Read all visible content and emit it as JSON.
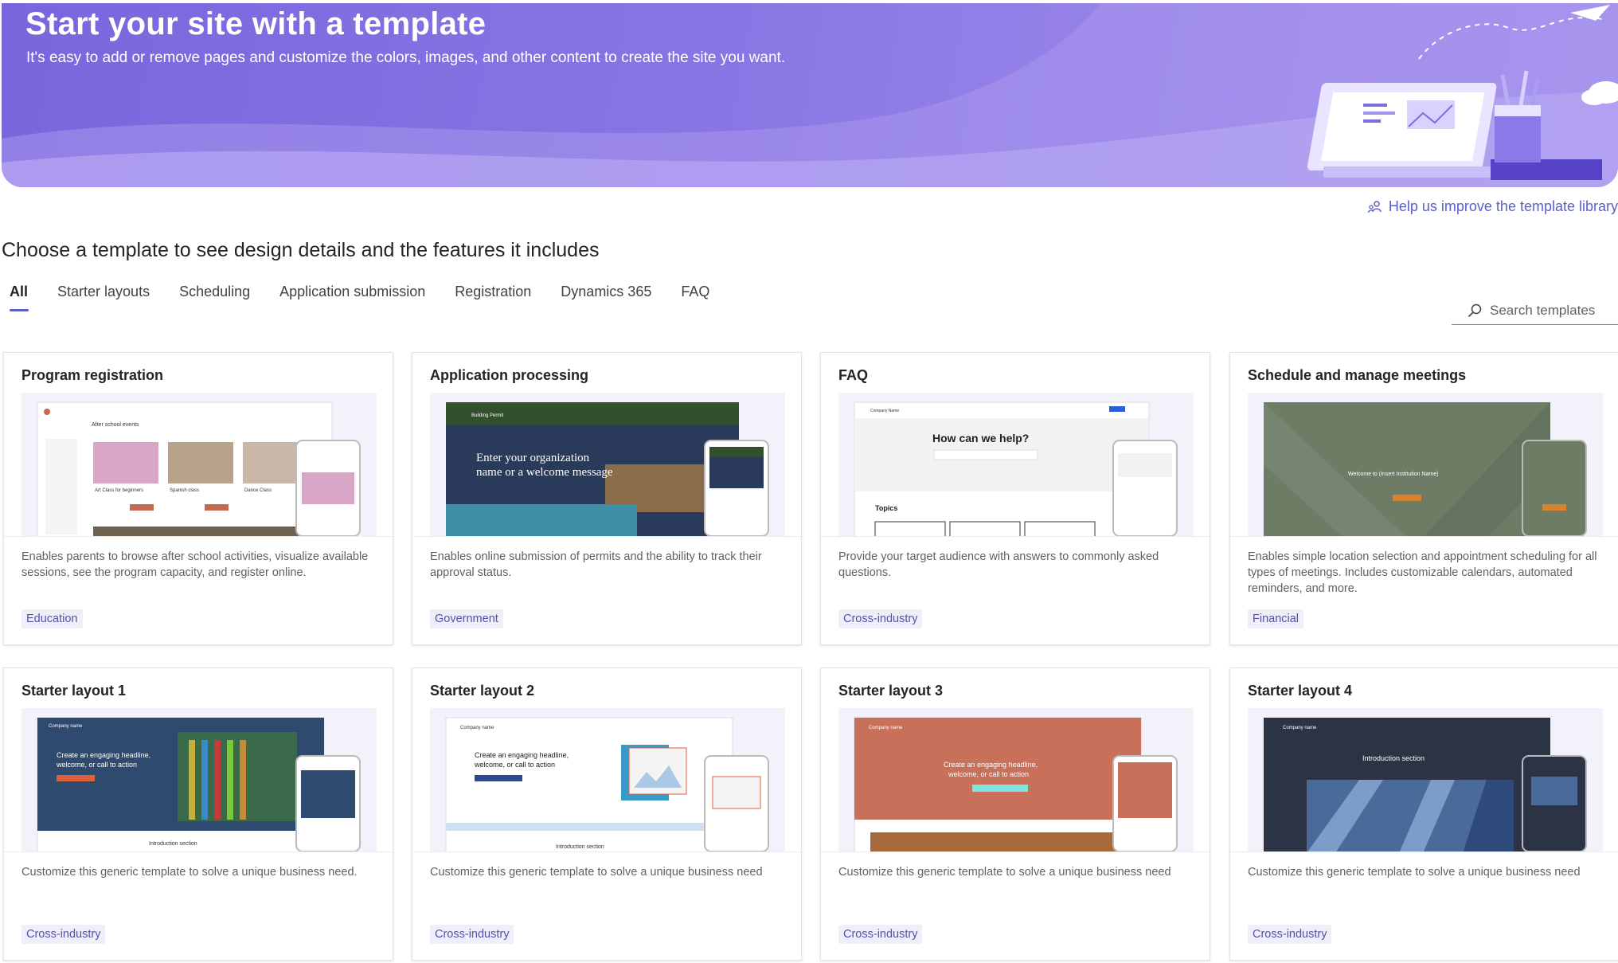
{
  "banner": {
    "title": "Start your site with a template",
    "subtitle": "It's easy to add or remove pages and customize the colors, images, and other content to create the site you want."
  },
  "help_link": "Help us improve the template library",
  "section_title": "Choose a template to see design details and the features it includes",
  "tabs": [
    "All",
    "Starter layouts",
    "Scheduling",
    "Application submission",
    "Registration",
    "Dynamics 365",
    "FAQ"
  ],
  "search": {
    "placeholder": "Search templates"
  },
  "cards": [
    {
      "title": "Program registration",
      "desc": "Enables parents to browse after school activities, visualize available sessions, see the program capacity, and register online.",
      "tag": "Education",
      "preview": "edu"
    },
    {
      "title": "Application processing",
      "desc": "Enables online submission of permits and the ability to track their approval status.",
      "tag": "Government",
      "preview": "gov"
    },
    {
      "title": "FAQ",
      "desc": "Provide your target audience with answers to commonly asked questions.",
      "tag": "Cross-industry",
      "preview": "faq"
    },
    {
      "title": "Schedule and manage meetings",
      "desc": "Enables simple location selection and appointment scheduling for all types of meetings. Includes customizable calendars, automated reminders, and more.",
      "tag": "Financial",
      "preview": "fin"
    },
    {
      "title": "Starter layout 1",
      "desc": "Customize this generic template to solve a unique business need.",
      "tag": "Cross-industry",
      "preview": "s1"
    },
    {
      "title": "Starter layout 2",
      "desc": "Customize this generic template to solve a unique business need",
      "tag": "Cross-industry",
      "preview": "s2"
    },
    {
      "title": "Starter layout 3",
      "desc": "Customize this generic template to solve a unique business need",
      "tag": "Cross-industry",
      "preview": "s3"
    },
    {
      "title": "Starter layout 4",
      "desc": "Customize this generic template to solve a unique business need",
      "tag": "Cross-industry",
      "preview": "s4"
    }
  ],
  "previews": {
    "edu": {
      "header": "After school events",
      "cards": [
        "Art Class for beginners",
        "Spanish class",
        "Dance Class"
      ]
    },
    "gov": {
      "brand": "Building Permit",
      "headline_1": "Enter your organization",
      "headline_2": "name or a welcome message"
    },
    "faq": {
      "brand": "Company Name",
      "headline": "How can we help?",
      "topics": "Topics"
    },
    "fin": {
      "headline": "Welcome to (Insert Institution Name)"
    },
    "s1": {
      "brand": "Company name",
      "headline_1": "Create an engaging headline,",
      "headline_2": "welcome, or call to action",
      "intro": "Introduction section"
    },
    "s2": {
      "brand": "Company name",
      "headline_1": "Create an engaging headline,",
      "headline_2": "welcome, or call to action",
      "intro": "Introduction section"
    },
    "s3": {
      "brand": "Company name",
      "headline_1": "Create an engaging headline,",
      "headline_2": "welcome, or call to action"
    },
    "s4": {
      "brand": "Company name",
      "intro": "Introduction section"
    }
  },
  "colors": {
    "accent": "#5b5fc7",
    "banner_start": "#7966dd",
    "banner_end": "#a894ee",
    "tag_bg": "#f0eef8"
  }
}
